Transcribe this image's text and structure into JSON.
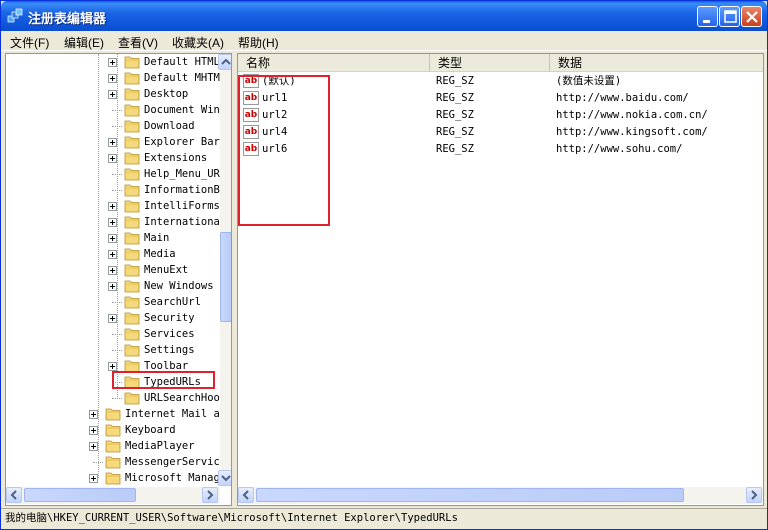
{
  "window": {
    "title": "注册表编辑器"
  },
  "menu": [
    "文件(F)",
    "编辑(E)",
    "查看(V)",
    "收藏夹(A)",
    "帮助(H)"
  ],
  "tree": {
    "items": [
      {
        "label": "Default HTML",
        "expandable": true
      },
      {
        "label": "Default MHTML",
        "expandable": true
      },
      {
        "label": "Desktop",
        "expandable": true
      },
      {
        "label": "Document Windows",
        "expandable": false
      },
      {
        "label": "Download",
        "expandable": false
      },
      {
        "label": "Explorer Bars",
        "expandable": true
      },
      {
        "label": "Extensions",
        "expandable": true
      },
      {
        "label": "Help_Menu_URLs",
        "expandable": false
      },
      {
        "label": "InformationBar",
        "expandable": false
      },
      {
        "label": "IntelliForms",
        "expandable": true
      },
      {
        "label": "International",
        "expandable": true
      },
      {
        "label": "Main",
        "expandable": true
      },
      {
        "label": "Media",
        "expandable": true
      },
      {
        "label": "MenuExt",
        "expandable": true
      },
      {
        "label": "New Windows",
        "expandable": true
      },
      {
        "label": "SearchUrl",
        "expandable": false
      },
      {
        "label": "Security",
        "expandable": true
      },
      {
        "label": "Services",
        "expandable": false
      },
      {
        "label": "Settings",
        "expandable": false
      },
      {
        "label": "Toolbar",
        "expandable": true
      },
      {
        "label": "TypedURLs",
        "expandable": false,
        "selected": true
      },
      {
        "label": "URLSearchHooks",
        "expandable": false
      }
    ],
    "items_level1": [
      {
        "label": "Internet Mail and News",
        "expandable": true
      },
      {
        "label": "Keyboard",
        "expandable": true
      },
      {
        "label": "MediaPlayer",
        "expandable": true
      },
      {
        "label": "MessengerService",
        "expandable": false
      },
      {
        "label": "Microsoft Management Console",
        "expandable": true
      }
    ]
  },
  "columns": {
    "name": "名称",
    "type": "类型",
    "data": "数据"
  },
  "values": [
    {
      "name": "(默认)",
      "type": "REG_SZ",
      "data": "(数值未设置)"
    },
    {
      "name": "url1",
      "type": "REG_SZ",
      "data": "http://www.baidu.com/"
    },
    {
      "name": "url2",
      "type": "REG_SZ",
      "data": "http://www.nokia.com.cn/"
    },
    {
      "name": "url4",
      "type": "REG_SZ",
      "data": "http://www.kingsoft.com/"
    },
    {
      "name": "url6",
      "type": "REG_SZ",
      "data": "http://www.sohu.com/"
    }
  ],
  "value_icon_text": "ab",
  "status": {
    "path": "我的电脑\\HKEY_CURRENT_USER\\Software\\Microsoft\\Internet Explorer\\TypedURLs"
  },
  "icons": {
    "app": "registry-editor-icon",
    "minimize": "minimize-icon",
    "maximize": "maximize-icon",
    "close": "close-icon",
    "folder": "folder-icon",
    "string_value": "string-value-icon"
  },
  "colors": {
    "titlebar": "#0a5fe0",
    "highlight_box": "#e0202a",
    "string_icon": "#cc0000"
  }
}
